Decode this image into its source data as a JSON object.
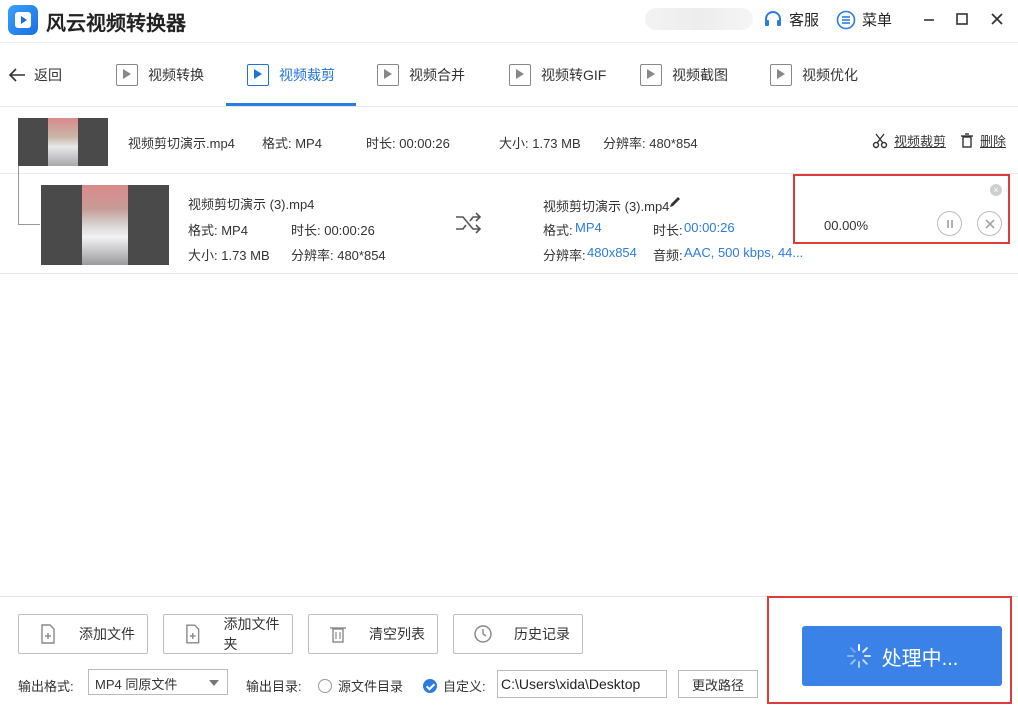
{
  "app": {
    "title": "风云视频转换器"
  },
  "titlebar": {
    "service_label": "客服",
    "menu_label": "菜单"
  },
  "nav": {
    "back_label": "返回",
    "tabs": [
      {
        "label": "视频转换",
        "icon": "video-convert-icon"
      },
      {
        "label": "视频裁剪",
        "icon": "video-crop-icon",
        "active": true
      },
      {
        "label": "视频合并",
        "icon": "video-merge-icon"
      },
      {
        "label": "视频转GIF",
        "icon": "gif-icon"
      },
      {
        "label": "视频截图",
        "icon": "screenshot-icon"
      },
      {
        "label": "视频优化",
        "icon": "optimize-icon"
      }
    ]
  },
  "source_file": {
    "name": "视频剪切演示.mp4",
    "format": "格式: MP4",
    "duration": "时长: 00:00:26",
    "size": "大小: 1.73 MB",
    "resolution": "分辨率: 480*854",
    "clip_action": "视频裁剪",
    "delete_action": "删除"
  },
  "output_file": {
    "input_name": "视频剪切演示 (3).mp4",
    "input_format": "格式: MP4",
    "input_duration": "时长: 00:00:26",
    "input_size": "大小: 1.73 MB",
    "input_resolution": "分辨率: 480*854",
    "output_name": "视频剪切演示 (3).mp4",
    "format_label": "格式:",
    "format_value": "MP4",
    "duration_label": "时长:",
    "duration_value": "00:00:26",
    "resolution_label": "分辨率:",
    "resolution_value": "480x854",
    "audio_label": "音频:",
    "audio_value": "AAC, 500 kbps, 44...",
    "progress_text": "00.00%"
  },
  "bottom": {
    "add_file": "添加文件",
    "add_folder": "添加文件夹",
    "clear_list": "清空列表",
    "history": "历史记录",
    "output_format_label": "输出格式:",
    "output_format_value": "MP4 同原文件",
    "output_dir_label": "输出目录:",
    "source_dir_option": "源文件目录",
    "custom_option": "自定义:",
    "path_value": "C:\\Users\\xida\\Desktop",
    "change_path": "更改路径",
    "process_label": "处理中..."
  },
  "colors": {
    "accent": "#2b7ce0",
    "process_button": "#3b82e8",
    "highlight_border": "#e03a3a"
  }
}
